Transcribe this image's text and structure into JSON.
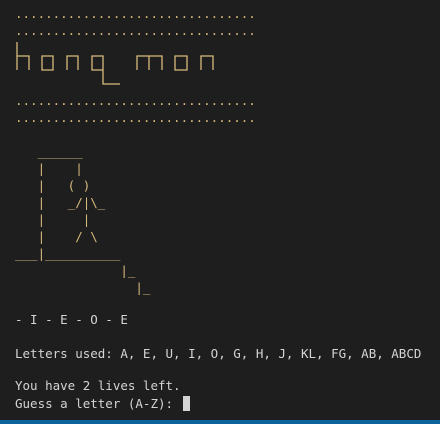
{
  "banner": {
    "dots_top_1": "................................",
    "dots_top_2": "................................",
    "logo_line_1": "|_    _   _   _   __   _   _",
    "logo_line_2": "| |  |_|  | |  |_|  | | |  |_|  | |",
    "logo_line_3": "             _|",
    "dots_bottom_1": "................................",
    "dots_bottom_2": "................................",
    "logo_alt": "hangman"
  },
  "gallows": {
    "line_1": "   ______",
    "line_2": "   |    |",
    "line_3": "   |   ( )",
    "line_4": "   |   _/|\\_",
    "line_5": "   |     |",
    "line_6": "   |    / \\",
    "line_7": "___|__________",
    "line_8": "              |_",
    "line_9": "                |_"
  },
  "game": {
    "word_state": "- I - E - O - E",
    "letters_used": "Letters used: A, E, U, I, O, G, H, J, KL, FG, AB, ABCD",
    "lives_left": "You have 2 lives left.",
    "prompt": "Guess a letter (A-Z): "
  },
  "colors": {
    "background": "#1e1e1e",
    "ascii_art": "#d7ba7d",
    "text": "#d4d4d4",
    "status_bar": "#0e639c"
  }
}
